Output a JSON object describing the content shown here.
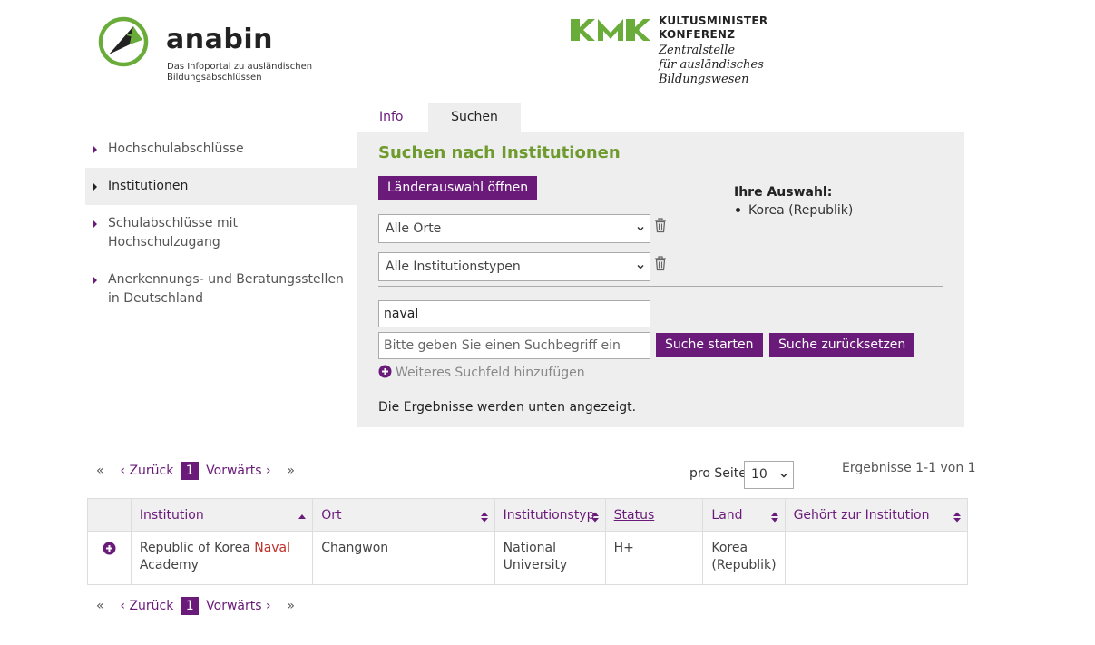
{
  "header": {
    "anabin_word": "anabin",
    "anabin_tagline_1": "Das Infoportal zu ausländischen",
    "anabin_tagline_2": "Bildungsabschlüssen",
    "kmk_name_1": "KULTUSMINISTER",
    "kmk_name_2": "KONFERENZ",
    "kmk_sub_1": "Zentralstelle",
    "kmk_sub_2": "für ausländisches",
    "kmk_sub_3": "Bildungswesen"
  },
  "sidebar": {
    "items": [
      {
        "label": "Hochschulabschlüsse"
      },
      {
        "label": "Institutionen"
      },
      {
        "label": "Schulabschlüsse mit Hochschulzugang"
      },
      {
        "label": "Anerkennungs- und Beratungsstellen in Deutschland"
      }
    ]
  },
  "tabs": {
    "info": "Info",
    "suchen": "Suchen"
  },
  "search": {
    "title": "Suchen nach Institutionen",
    "laender_button": "Länderauswahl öffnen",
    "auswahl_title": "Ihre Auswahl:",
    "auswahl_items": [
      "Korea (Republik)"
    ],
    "orte_select": "Alle Orte",
    "typen_select": "Alle Institutionstypen",
    "field1_value": "naval",
    "field2_placeholder": "Bitte geben Sie einen Suchbegriff ein",
    "start_button": "Suche starten",
    "reset_button": "Suche zurücksetzen",
    "add_field": "Weiteres Suchfeld hinzufügen",
    "result_note": "Die Ergebnisse werden unten angezeigt."
  },
  "pager": {
    "first": "«",
    "prev": "‹ Zurück",
    "current": "1",
    "next": "Vorwärts ›",
    "last": "»"
  },
  "per_page": {
    "label": "pro Seite",
    "value": "10"
  },
  "result_count": "Ergebnisse 1-1 von 1",
  "table": {
    "columns": {
      "institution": "Institution",
      "ort": "Ort",
      "typ": "Institutionstyp",
      "status": "Status",
      "land": "Land",
      "gehoert": "Gehört zur Institution"
    },
    "rows": [
      {
        "institution_pre": "Republic of Korea",
        "institution_match": "Naval",
        "institution_post": "Academy",
        "ort": "Changwon",
        "typ_1": "National",
        "typ_2": "University",
        "status": "H+",
        "land_1": "Korea",
        "land_2": "(Republik)",
        "gehoert": ""
      }
    ]
  },
  "colors": {
    "accent_purple": "#6a1b7a",
    "accent_green": "#6e9a2e",
    "highlight_red": "#c0302a",
    "panel_gray": "#eeeeee"
  },
  "icons": {
    "sidebar_caret": "caret-right-icon",
    "trash": "trash-icon",
    "add": "plus-circle-icon",
    "sort": "sort-icon",
    "expand": "expand-row-icon",
    "dropdown": "chevron-down-icon"
  }
}
